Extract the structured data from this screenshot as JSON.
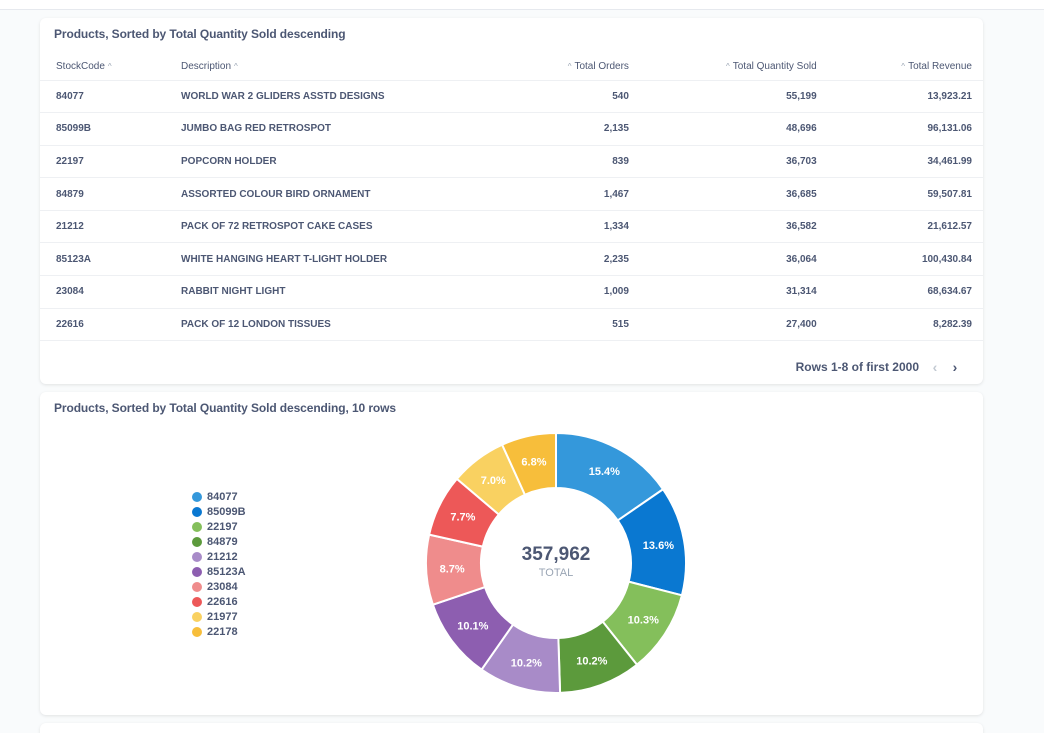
{
  "table_card": {
    "title": "Products, Sorted by Total Quantity Sold descending",
    "columns": [
      "StockCode",
      "Description",
      "Total Orders",
      "Total Quantity Sold",
      "Total Revenue"
    ],
    "rows": [
      [
        "84077",
        "WORLD WAR 2 GLIDERS ASSTD DESIGNS",
        "540",
        "55,199",
        "13,923.21"
      ],
      [
        "85099B",
        "JUMBO BAG RED RETROSPOT",
        "2,135",
        "48,696",
        "96,131.06"
      ],
      [
        "22197",
        "POPCORN HOLDER",
        "839",
        "36,703",
        "34,461.99"
      ],
      [
        "84879",
        "ASSORTED COLOUR BIRD ORNAMENT",
        "1,467",
        "36,685",
        "59,507.81"
      ],
      [
        "21212",
        "PACK OF 72 RETROSPOT CAKE CASES",
        "1,334",
        "36,582",
        "21,612.57"
      ],
      [
        "85123A",
        "WHITE HANGING HEART T-LIGHT HOLDER",
        "2,235",
        "36,064",
        "100,430.84"
      ],
      [
        "23084",
        "RABBIT NIGHT LIGHT",
        "1,009",
        "31,314",
        "68,634.67"
      ],
      [
        "22616",
        "PACK OF 12 LONDON TISSUES",
        "515",
        "27,400",
        "8,282.39"
      ]
    ],
    "pagination": "Rows 1-8 of first 2000",
    "sort_icon": "chevron-up-icon",
    "prev_icon": "chevron-left-icon",
    "next_icon": "chevron-right-icon"
  },
  "chart_card": {
    "title": "Products, Sorted by Total Quantity Sold descending, 10 rows",
    "total_value": "357,962",
    "total_label": "TOTAL"
  },
  "chart_data": {
    "type": "pie",
    "title": "Products, Sorted by Total Quantity Sold descending, 10 rows",
    "donut": true,
    "total": 357962,
    "legend_position": "left",
    "slices": [
      {
        "label": "84077",
        "percent": 15.4,
        "percent_label": "15.4%",
        "color": "#3498db"
      },
      {
        "label": "85099B",
        "percent": 13.6,
        "percent_label": "13.6%",
        "color": "#0a78d1"
      },
      {
        "label": "22197",
        "percent": 10.3,
        "percent_label": "10.3%",
        "color": "#84bf5b"
      },
      {
        "label": "84879",
        "percent": 10.2,
        "percent_label": "10.2%",
        "color": "#5c9a3c"
      },
      {
        "label": "21212",
        "percent": 10.2,
        "percent_label": "10.2%",
        "color": "#a88bc8"
      },
      {
        "label": "85123A",
        "percent": 10.1,
        "percent_label": "10.1%",
        "color": "#8d5eb0"
      },
      {
        "label": "23084",
        "percent": 8.7,
        "percent_label": "8.7%",
        "color": "#ef8c8c"
      },
      {
        "label": "22616",
        "percent": 7.7,
        "percent_label": "7.7%",
        "color": "#ed5858"
      },
      {
        "label": "21977",
        "percent": 7.0,
        "percent_label": "7.0%",
        "color": "#f9d161"
      },
      {
        "label": "22178",
        "percent": 6.8,
        "percent_label": "6.8%",
        "color": "#f7be3b"
      }
    ]
  }
}
